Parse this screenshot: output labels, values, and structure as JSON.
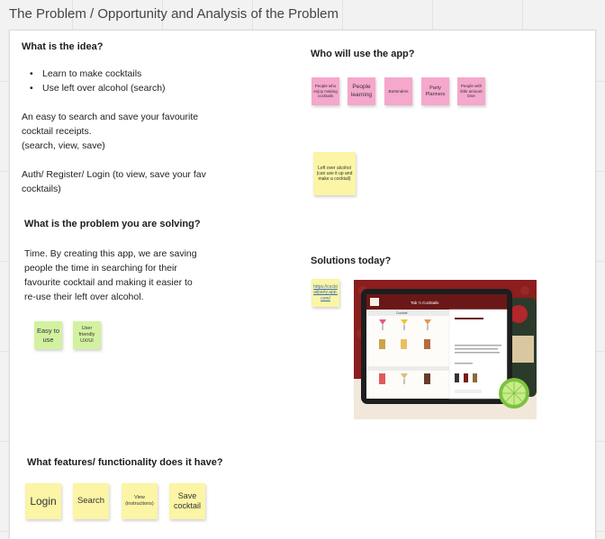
{
  "page": {
    "title": "The Problem / Opportunity and Analysis of the Problem"
  },
  "idea": {
    "heading": "What is the idea?",
    "bullets": [
      "Learn to make cocktails",
      "Use left over alcohol (search)"
    ],
    "para1_line1": "An easy to search and save your favourite",
    "para1_line2": "cocktail receipts.",
    "para1_line3": "(search, view, save)",
    "para2_line1": "Auth/ Register/ Login (to view, save your fav",
    "para2_line2": "cocktails)"
  },
  "users": {
    "heading": "Who will use the app?",
    "stickies": [
      "People who enjoy making cocktails",
      "People learning",
      "Bartenders",
      "Party Planners",
      "People with little amount time"
    ],
    "extra_sticky": "Left over alcohol (can use it up and make a cocktail)"
  },
  "problem": {
    "heading": "What is the problem you are solving?",
    "line1": "Time. By creating this app, we are saving",
    "line2": "people the time in searching for their",
    "line3": "favourite cocktail and making it easier to",
    "line4": "re-use their left over alcohol.",
    "stickies": [
      "Easy to use",
      "User friendly UX/UI"
    ]
  },
  "solutions": {
    "heading": "Solutions today?",
    "link_sticky": "https://cocktailparty.app.com/",
    "screen_title": "Tab 'n Cocktails",
    "sidebar_heading": "Cocktail"
  },
  "features": {
    "heading": "What features/ functionality does it have?",
    "stickies": [
      "Login",
      "Search",
      "View (instructions)",
      "Save cocktail"
    ]
  },
  "colors": {
    "pink_sticky": "#f5a7cc",
    "yellow_sticky": "#fbf5a5",
    "green_sticky": "#d3f2a0",
    "tablet_wall": "#8b1e1e"
  }
}
